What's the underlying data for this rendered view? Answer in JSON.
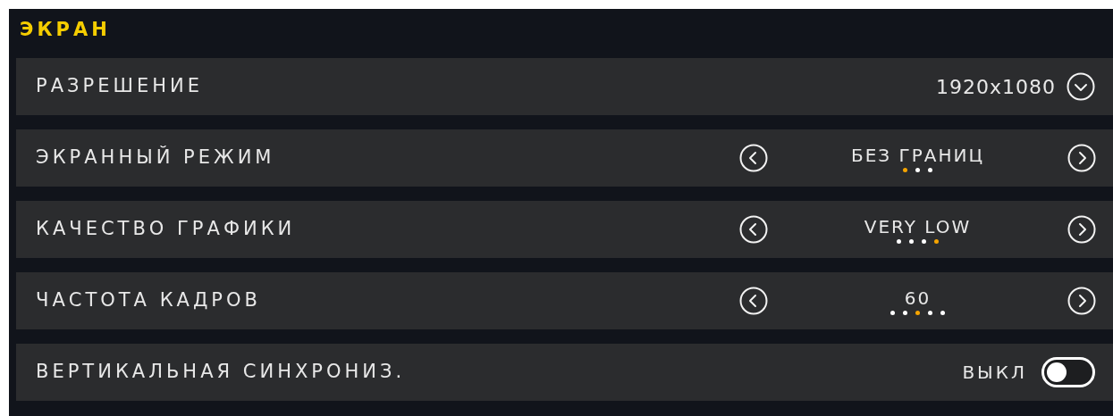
{
  "section": {
    "title": "ЭКРАН"
  },
  "settings": [
    {
      "kind": "dropdown",
      "label": "РАЗРЕШЕНИЕ",
      "value": "1920x1080"
    },
    {
      "kind": "selector",
      "label": "ЭКРАННЫЙ РЕЖИМ",
      "value": "БЕЗ ГРАНИЦ",
      "options": [
        {
          "selected": true
        },
        {
          "selected": false
        },
        {
          "selected": false
        }
      ]
    },
    {
      "kind": "selector",
      "label": "КАЧЕСТВО ГРАФИКИ",
      "value": "VERY LOW",
      "options": [
        {
          "selected": false
        },
        {
          "selected": false
        },
        {
          "selected": false
        },
        {
          "selected": true
        }
      ]
    },
    {
      "kind": "selector",
      "label": "ЧАСТОТА КАДРОВ",
      "value": "60",
      "options": [
        {
          "selected": false
        },
        {
          "selected": false
        },
        {
          "selected": true
        },
        {
          "selected": false
        },
        {
          "selected": false
        }
      ]
    },
    {
      "kind": "toggle",
      "label": "ВЕРТИКАЛЬНАЯ СИНХРОНИЗ.",
      "value": "ВЫКЛ",
      "on": false
    }
  ]
}
